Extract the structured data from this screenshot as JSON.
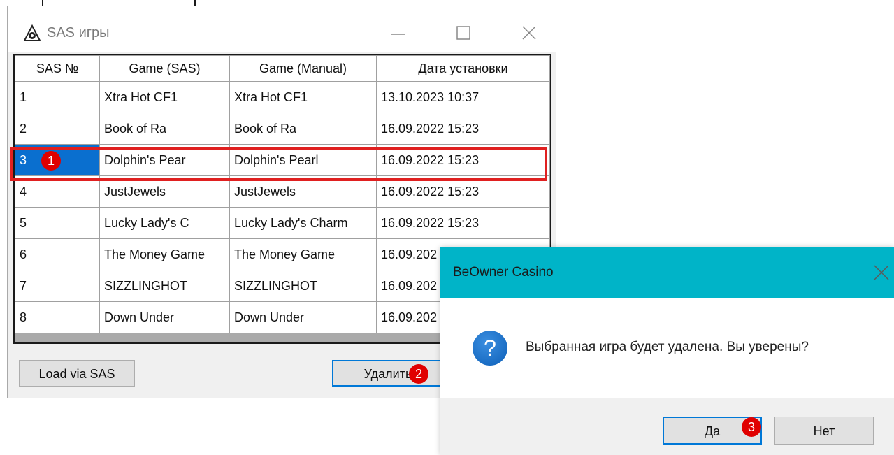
{
  "window": {
    "title": "SAS игры",
    "columns": [
      "SAS №",
      "Game (SAS)",
      "Game (Manual)",
      "Дата установки"
    ],
    "rows": [
      {
        "sas": "1",
        "game_sas": "Xtra Hot CF1",
        "game_manual": "Xtra Hot CF1",
        "date": "13.10.2023 10:37"
      },
      {
        "sas": "2",
        "game_sas": "Book of Ra",
        "game_manual": "Book of Ra",
        "date": "16.09.2022 15:23"
      },
      {
        "sas": "3",
        "game_sas": "Dolphin's Pear",
        "game_manual": "Dolphin's Pearl",
        "date": "16.09.2022 15:23"
      },
      {
        "sas": "4",
        "game_sas": "JustJewels",
        "game_manual": "JustJewels",
        "date": "16.09.2022 15:23"
      },
      {
        "sas": "5",
        "game_sas": "Lucky Lady's C",
        "game_manual": "Lucky Lady's Charm",
        "date": "16.09.2022 15:23"
      },
      {
        "sas": "6",
        "game_sas": "The Money Game",
        "game_manual": "The Money Game",
        "date": "16.09.202"
      },
      {
        "sas": "7",
        "game_sas": "SIZZLINGHOT",
        "game_manual": "SIZZLINGHOT",
        "date": "16.09.202"
      },
      {
        "sas": "8",
        "game_sas": "Down Under",
        "game_manual": "Down Under",
        "date": "16.09.202"
      }
    ],
    "selected_row": "3",
    "load_button": "Load via SAS",
    "delete_button": "Удалить"
  },
  "dialog": {
    "title": "BeOwner Casino",
    "icon": "question-icon",
    "message": "Выбранная игра будет удалена. Вы уверены?",
    "yes_button": "Да",
    "no_button": "Нет"
  },
  "badges": {
    "b1": "1",
    "b2": "2",
    "b3": "3"
  },
  "colors": {
    "selection": "#0a6fcf",
    "highlight": "#e02020",
    "badge": "#e00000",
    "dialog_title": "#00b4c8"
  }
}
